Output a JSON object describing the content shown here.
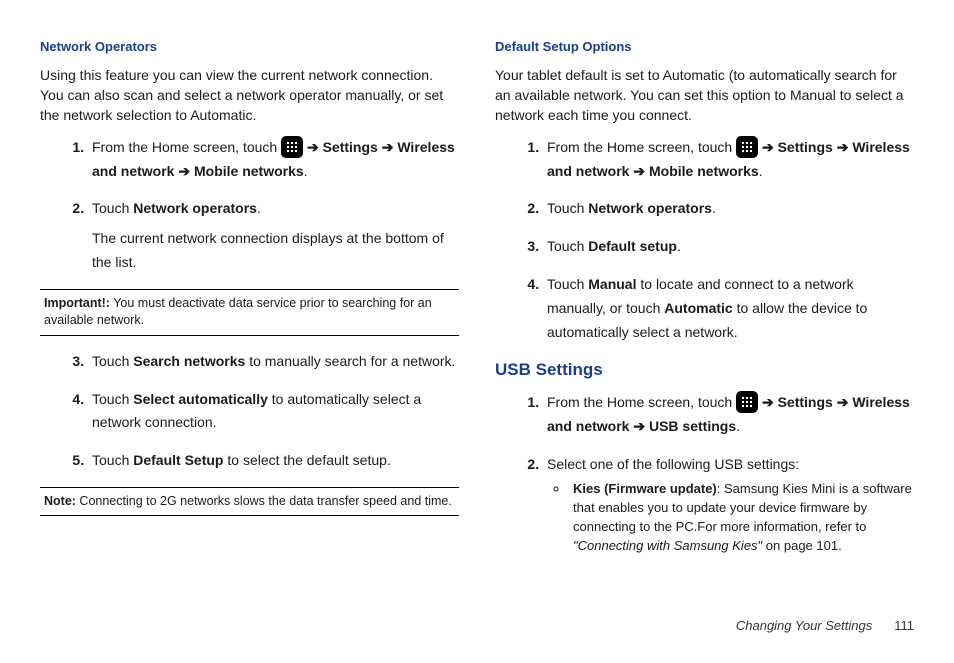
{
  "arrow": "➔",
  "left": {
    "h1": "Network Operators",
    "p1": "Using this feature you can view the current network connection. You can also scan and select a network operator manually, or set the network selection to Automatic.",
    "s1a": "From the Home screen, touch ",
    "s1b": " Settings ",
    "s1c": " Wireless and network ",
    "s1d": " Mobile networks",
    "s1e": ".",
    "s2a": "Touch ",
    "s2b": "Network operators",
    "s2c": ".",
    "s2d": "The current network connection displays at the bottom of the list.",
    "impLabel": "Important!:",
    "imp": " You must deactivate data service prior to searching for an available network.",
    "s3a": "Touch ",
    "s3b": "Search networks",
    "s3c": " to manually search for a network.",
    "s4a": "Touch ",
    "s4b": "Select automatically",
    "s4c": " to automatically select a network connection.",
    "s5a": "Touch ",
    "s5b": "Default Setup",
    "s5c": " to select the default setup.",
    "noteLabel": "Note:",
    "note": " Connecting to 2G networks slows the data transfer speed and time."
  },
  "right": {
    "h1": "Default Setup Options",
    "p1": "Your tablet default is set to Automatic (to automatically search for an available network. You can set this option to Manual to select a network each time you connect.",
    "s1a": "From the Home screen, touch ",
    "s1b": " Settings ",
    "s1c": " Wireless and network ",
    "s1d": " Mobile networks",
    "s1e": ".",
    "s2a": "Touch ",
    "s2b": "Network operators",
    "s2c": ".",
    "s3a": "Touch ",
    "s3b": "Default setup",
    "s3c": ".",
    "s4a": "Touch ",
    "s4b": "Manual",
    "s4c": " to locate and connect to a network manually, or touch ",
    "s4d": "Automatic",
    "s4e": " to allow the device to automatically select a network.",
    "h2": "USB Settings",
    "u1a": "From the Home screen, touch ",
    "u1b": " Settings ",
    "u1c": " Wireless and network ",
    "u1d": " USB settings",
    "u1e": ".",
    "u2": "Select one of the following USB settings:",
    "b1a": "Kies (Firmware update)",
    "b1b": ": Samsung Kies Mini is a software that enables you to update your device firmware by connecting to the PC.For more information, refer to ",
    "b1c": "\"Connecting with Samsung Kies\"",
    "b1d": "  on page 101."
  },
  "footer": {
    "title": "Changing Your Settings",
    "page": "111"
  }
}
